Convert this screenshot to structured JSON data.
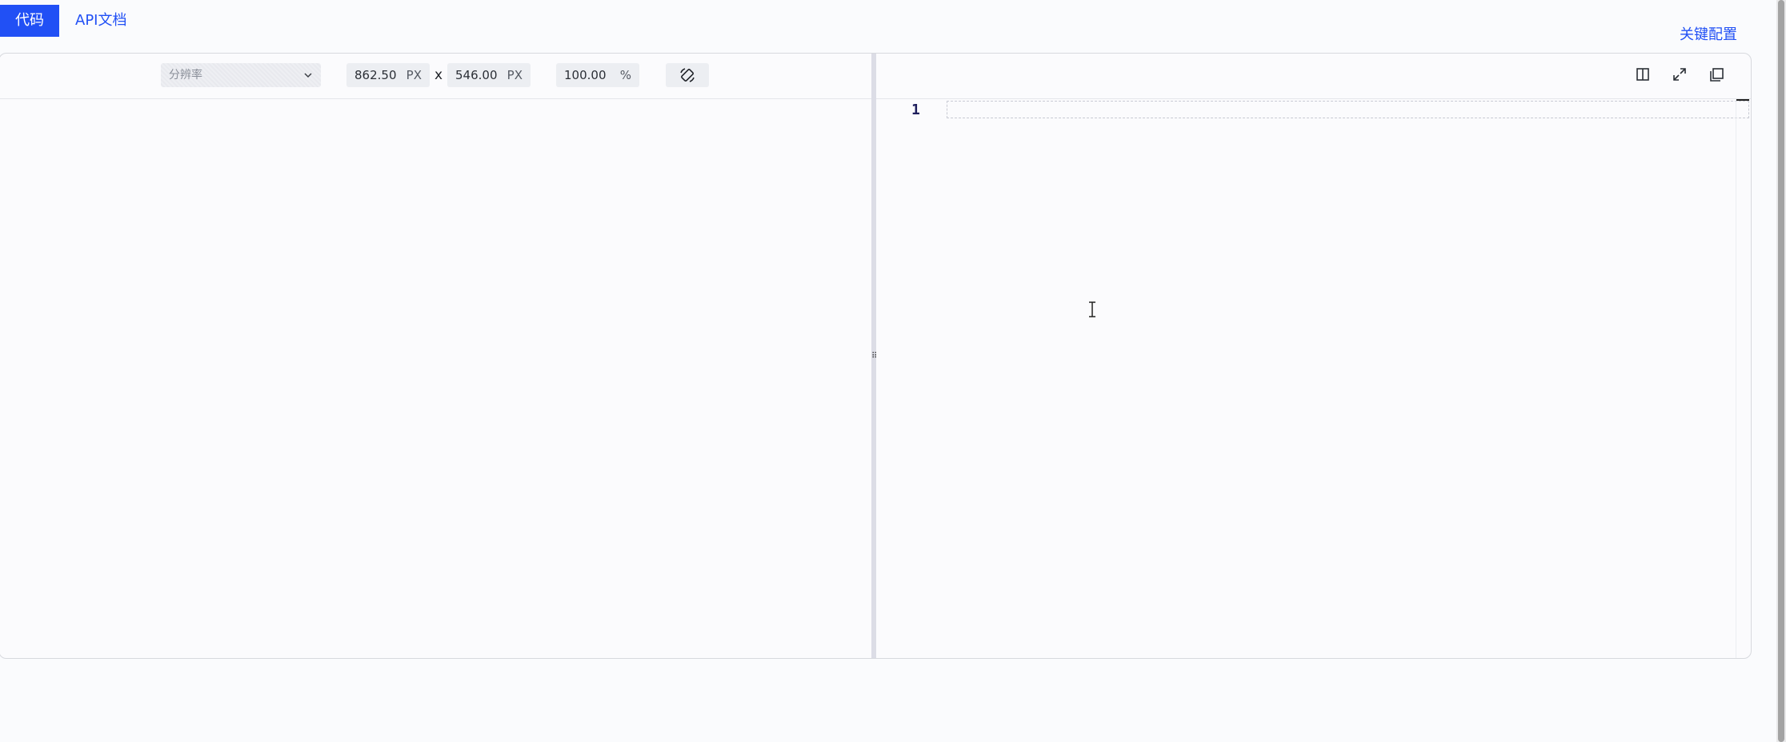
{
  "tabs": [
    {
      "label": "代码",
      "active": true
    },
    {
      "label": "API文档",
      "active": false
    }
  ],
  "header": {
    "key_config_label": "关键配置"
  },
  "preview_toolbar": {
    "resolution_placeholder": "分辨率",
    "width_value": "862.50",
    "width_unit": "PX",
    "times_symbol": "x",
    "height_value": "546.00",
    "height_unit": "PX",
    "zoom_value": "100.00",
    "zoom_unit": "%",
    "rotate_icon": "rotate-device-icon"
  },
  "editor_toolbar": {
    "icons": [
      "split-view-icon",
      "expand-icon",
      "copy-icon"
    ]
  },
  "editor": {
    "line_numbers": [
      "1"
    ],
    "content": ""
  },
  "colors": {
    "accent": "#2150f5",
    "background": "#fafbfd",
    "line_number": "#1d1d5c"
  }
}
